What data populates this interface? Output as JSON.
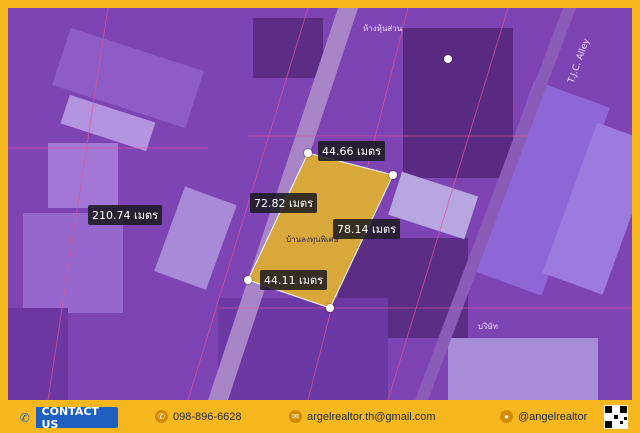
{
  "map": {
    "measurements": [
      {
        "id": "west-outer",
        "text": "210.74 เมตร"
      },
      {
        "id": "top",
        "text": "44.66 เมตร"
      },
      {
        "id": "left-side",
        "text": "72.82 เมตร"
      },
      {
        "id": "right-side",
        "text": "78.14 เมตร"
      },
      {
        "id": "bottom",
        "text": "44.11 เมตร"
      }
    ],
    "parcel_label": "บ้านลงทุนพิเศษ",
    "road_label": "T.J.C. Alley",
    "poi_labels": [
      "ห้างหุ้นส่วน",
      "บริษัท"
    ],
    "colors": {
      "parcel": "#d9a83a",
      "tint": "#7a3fae",
      "frame": "#f7b81f",
      "button": "#1f5fbf"
    }
  },
  "footer": {
    "contact_label": "CONTACT US",
    "phone": "098-896-6628",
    "email": "argelrealtor.th@gmail.com",
    "line": "@angelrealtor",
    "icons": [
      "phone-icon",
      "email-icon",
      "line-icon"
    ]
  }
}
